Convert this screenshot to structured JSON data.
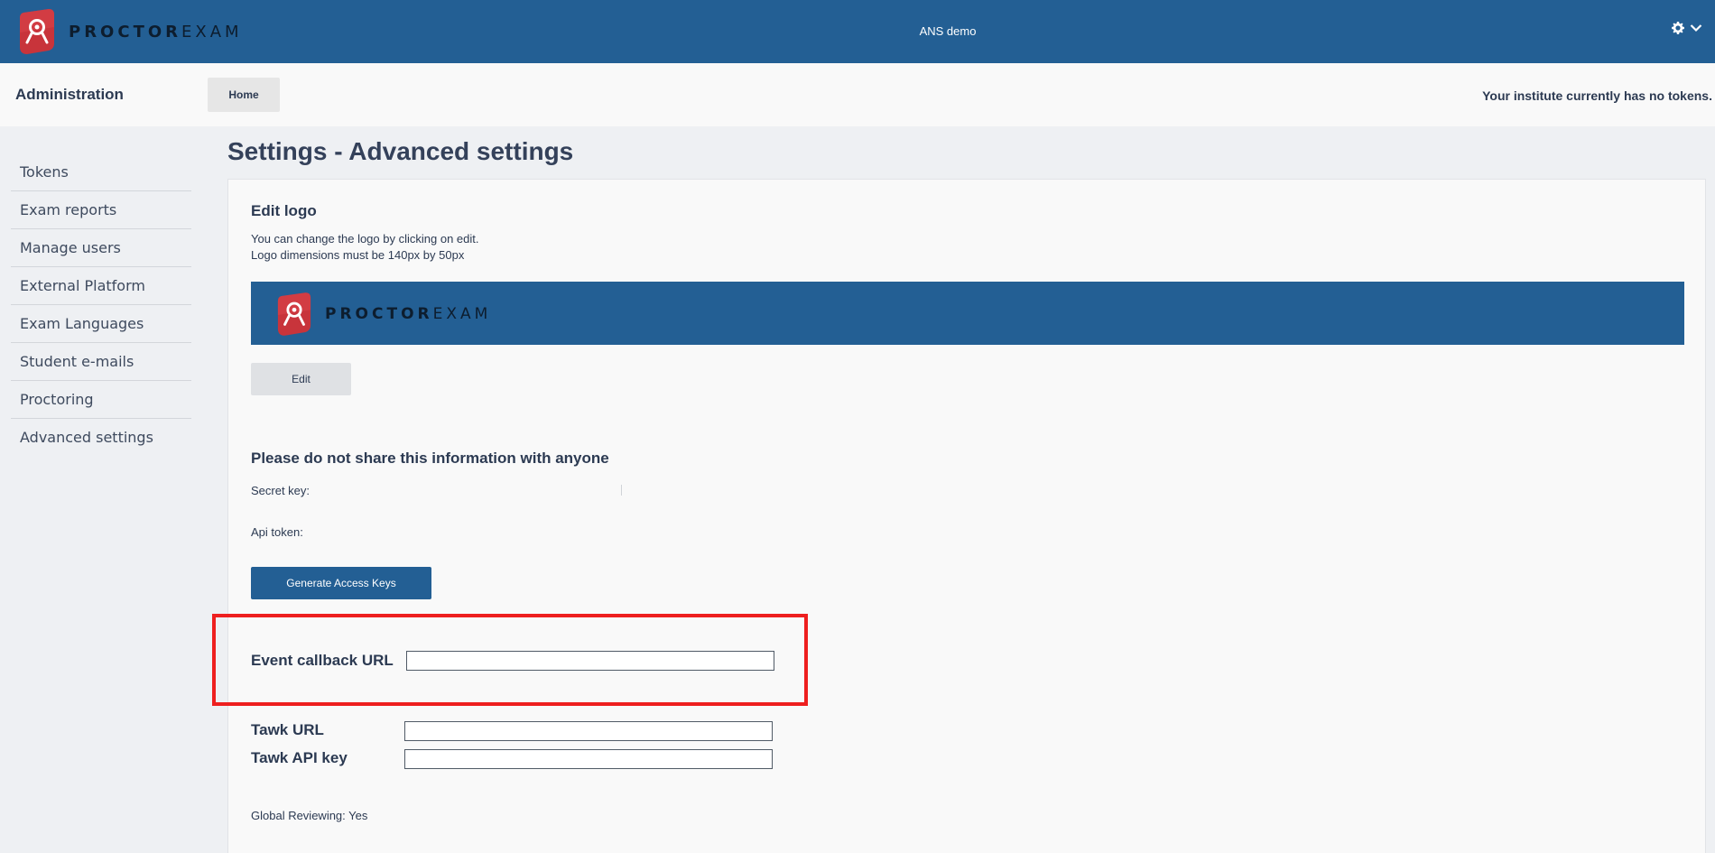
{
  "header": {
    "brand_bold": "PROCTOR",
    "brand_light": "EXAM",
    "institute": "ANS demo",
    "settings_icon": "gear-icon",
    "menu_icon": "chevron-down-icon",
    "color": "#235f94"
  },
  "subbar": {
    "title": "Administration",
    "home_label": "Home",
    "token_message": "Your institute currently has no tokens."
  },
  "sidebar": {
    "items": [
      {
        "label": "Tokens"
      },
      {
        "label": "Exam reports"
      },
      {
        "label": "Manage users"
      },
      {
        "label": "External Platform"
      },
      {
        "label": "Exam Languages"
      },
      {
        "label": "Student e-mails"
      },
      {
        "label": "Proctoring"
      },
      {
        "label": "Advanced settings"
      }
    ]
  },
  "main": {
    "page_title": "Settings - Advanced settings",
    "edit_logo": {
      "heading": "Edit logo",
      "line1": "You can change the logo by clicking on edit.",
      "line2": "Logo dimensions must be 140px by 50px",
      "logo_bold": "PROCTOR",
      "logo_light": "EXAM",
      "edit_label": "Edit"
    },
    "secrets": {
      "heading": "Please do not share this information with anyone",
      "secret_key_label": "Secret key:",
      "secret_key_value": "",
      "api_token_label": "Api token:",
      "api_token_value": "",
      "generate_label": "Generate Access Keys"
    },
    "callback": {
      "label": "Event callback URL",
      "value": ""
    },
    "tawk": {
      "url_label": "Tawk URL",
      "url_value": "",
      "api_key_label": "Tawk API key",
      "api_key_value": ""
    },
    "global_reviewing": "Global Reviewing: Yes"
  },
  "highlight_color": "#ee1f1f"
}
